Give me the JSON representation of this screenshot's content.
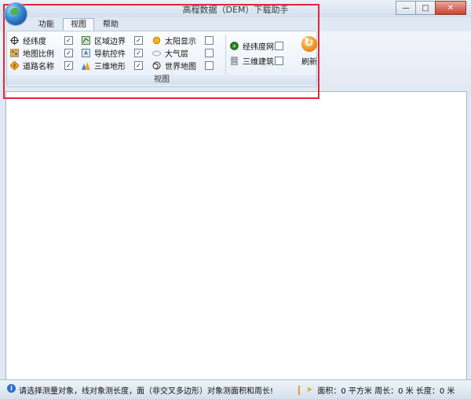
{
  "window": {
    "title": "高程数据（DEM）下载助手"
  },
  "window_controls": {
    "minimize": "—",
    "maximize": "□",
    "close": "✕"
  },
  "tabs": [
    {
      "label": "功能"
    },
    {
      "label": "视图"
    },
    {
      "label": "帮助"
    }
  ],
  "ribbon": {
    "group_label": "视图",
    "items": [
      {
        "label": "经纬度",
        "checked": "✓",
        "icon": "crosshair-icon"
      },
      {
        "label": "地图比例",
        "checked": "✓",
        "icon": "scale-icon"
      },
      {
        "label": "道路名称",
        "checked": "✓",
        "icon": "road-icon"
      },
      {
        "label": "区域边界",
        "checked": "✓",
        "icon": "boundary-icon"
      },
      {
        "label": "导航控件",
        "checked": "✓",
        "icon": "navigation-icon"
      },
      {
        "label": "三维地形",
        "checked": "✓",
        "icon": "terrain-icon"
      },
      {
        "label": "太阳显示",
        "checked": "",
        "icon": "sun-icon"
      },
      {
        "label": "大气层",
        "checked": "",
        "icon": "atmosphere-icon"
      },
      {
        "label": "世界地图",
        "checked": "",
        "icon": "world-map-icon"
      },
      {
        "label": "经纬度网",
        "checked": "",
        "icon": "grid-icon"
      },
      {
        "label": "三维建筑",
        "checked": "",
        "icon": "building-icon"
      }
    ],
    "refresh_label": "刷新"
  },
  "status": {
    "message": "请选择测量对象，线对象测长度，面（非交叉多边形）对象测面积和周长!",
    "measure": "面积：0 平方米 周长：0 米 长度：0 米"
  },
  "colors": {
    "highlight": "#e3263a",
    "accent": "#f08a12"
  }
}
